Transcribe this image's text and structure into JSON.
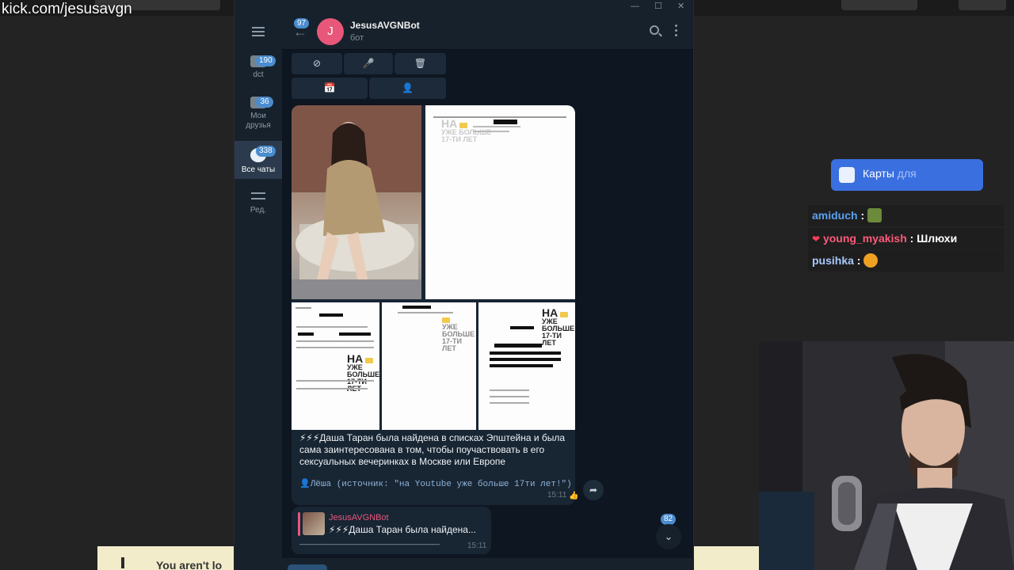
{
  "stream": {
    "url": "kick.com/jesusavgn",
    "banner_text": "You aren't lo"
  },
  "telegram": {
    "rail": {
      "folders": [
        {
          "label": "dct",
          "badge": "190"
        },
        {
          "label": "Мои друзья",
          "badge": "36"
        },
        {
          "label": "Все чаты",
          "badge": "338",
          "active": true
        },
        {
          "label": "Ред."
        }
      ]
    },
    "header": {
      "unread": "97",
      "avatar_letter": "J",
      "name": "JesusAVGNBot",
      "subtitle": "бот"
    },
    "keyboard": {
      "row1": [
        "⊘",
        "🎤",
        "🗑"
      ],
      "row2": [
        "📅",
        "👤"
      ]
    },
    "album": {
      "stamp_na": "НА",
      "stamp_lines": [
        "УЖЕ БОЛЬШЕ",
        "17-ТИ ЛЕТ"
      ]
    },
    "message": {
      "text": "⚡⚡⚡Даша Таран была найдена в списках Эпштейна и была сама заинтересована в том, чтобы поучаствовать в его сексуальных вечеринках в Москве или Европе",
      "source": "👤Лёша (источник: \"на Youtube уже больше 17ти лет!\")",
      "time": "15:11",
      "reaction": "👍"
    },
    "reply": {
      "name": "JesusAVGNBot",
      "text": "⚡⚡⚡Даша Таран была найдена...",
      "dashes": "——————————————————————",
      "time": "15:11"
    },
    "scroll_count": "82"
  },
  "overlay": {
    "cards_button": {
      "label": "Карты",
      "suffix": "для"
    },
    "chat": [
      {
        "user": "amiduch",
        "user_color": "#5aa0f0",
        "text": ""
      },
      {
        "user": "young_myakish",
        "user_color": "#ff5a7a",
        "text": "Шлюхи"
      },
      {
        "user": "pusihka",
        "user_color": "#a8c8ff",
        "text": ""
      }
    ]
  }
}
